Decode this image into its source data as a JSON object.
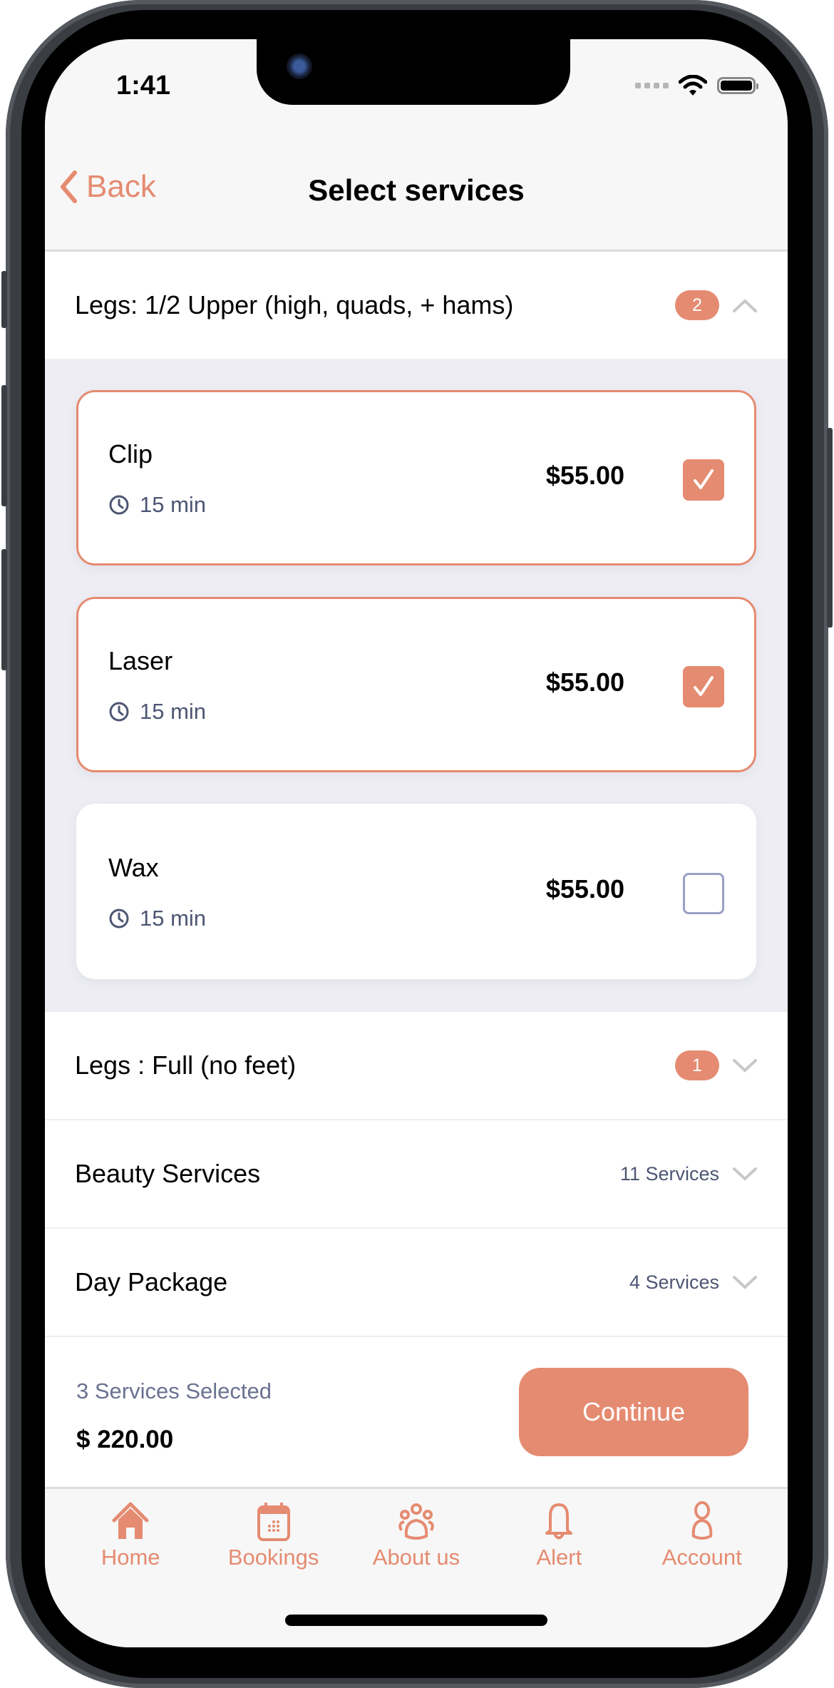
{
  "status_bar": {
    "time": "1:41"
  },
  "nav": {
    "back_label": "Back",
    "title": "Select services"
  },
  "accent_color": "#E58B71",
  "groups": [
    {
      "title": "Legs: 1/2 Upper (high, quads, + hams)",
      "badge": "2",
      "expanded": true,
      "services": [
        {
          "name": "Clip",
          "duration": "15 min",
          "price": "$55.00",
          "selected": true
        },
        {
          "name": "Laser",
          "duration": "15 min",
          "price": "$55.00",
          "selected": true
        },
        {
          "name": "Wax",
          "duration": "15 min",
          "price": "$55.00",
          "selected": false
        }
      ]
    },
    {
      "title": "Legs : Full (no feet)",
      "badge": "1",
      "expanded": false
    },
    {
      "title": "Beauty Services",
      "count": "11 Services",
      "expanded": false
    },
    {
      "title": "Day Package",
      "count": "4 Services",
      "expanded": false
    }
  ],
  "footer": {
    "selected_text": "3 Services Selected",
    "total": "$ 220.00",
    "continue_label": "Continue"
  },
  "tabbar": [
    {
      "label": "Home",
      "icon": "home-icon"
    },
    {
      "label": "Bookings",
      "icon": "calendar-icon"
    },
    {
      "label": "About us",
      "icon": "group-icon"
    },
    {
      "label": "Alert",
      "icon": "bell-icon"
    },
    {
      "label": "Account",
      "icon": "person-icon"
    }
  ]
}
